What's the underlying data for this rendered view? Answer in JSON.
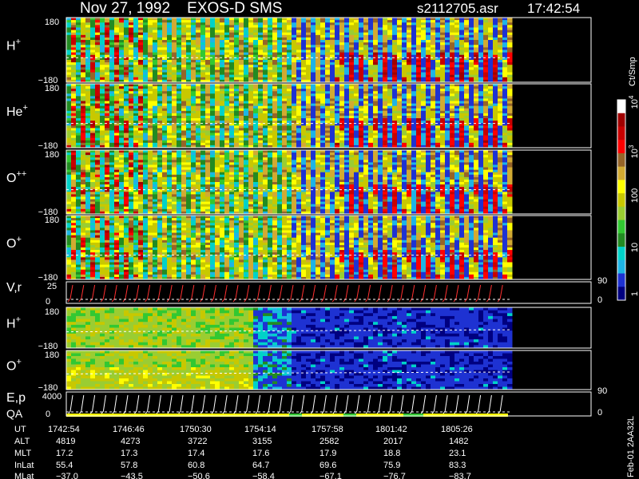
{
  "header": {
    "title": "Nov 27, 1992    EXOS-D SMS",
    "file": "s2112705.asr",
    "time": "17:42:54"
  },
  "chart_data": {
    "type": "heatmap",
    "panels": [
      {
        "label": "H",
        "sup": "+",
        "ytop": "180",
        "ybot": "−180",
        "kind": "spin",
        "intensity": 1.0
      },
      {
        "label": "He",
        "sup": "+",
        "ytop": "180",
        "ybot": "−180",
        "kind": "spin",
        "intensity": 0.85
      },
      {
        "label": "O",
        "sup": "++",
        "ytop": "180",
        "ybot": "−180",
        "kind": "spin",
        "intensity": 0.8
      },
      {
        "label": "O",
        "sup": "+",
        "ytop": "180",
        "ybot": "−180",
        "kind": "spin",
        "intensity": 0.75
      },
      {
        "label": "V,r",
        "sup": "",
        "ytop": "25",
        "ybot": "0",
        "kind": "line",
        "right_top": "90",
        "right_bot": "0"
      },
      {
        "label": "H",
        "sup": "+",
        "ytop": "180",
        "ybot": "−180",
        "kind": "smooth"
      },
      {
        "label": "O",
        "sup": "+",
        "ytop": "180",
        "ybot": "−180",
        "kind": "smooth"
      },
      {
        "label": "E,p",
        "label2": "QA",
        "sup": "",
        "ytop": "4000",
        "ybot": "0",
        "kind": "line",
        "right_top": "90",
        "right_bot": "0"
      }
    ],
    "colorbar": {
      "unit": "Ct/Smp",
      "ticks": [
        {
          "base": "10",
          "exp": "4"
        },
        {
          "base": "10",
          "exp": "3"
        },
        {
          "base": "100",
          "exp": ""
        },
        {
          "base": "10",
          "exp": ""
        },
        {
          "base": "1",
          "exp": ""
        }
      ],
      "colors": [
        "#000080",
        "#1e32d2",
        "#1eb4e6",
        "#00d2c8",
        "#228b22",
        "#32c832",
        "#9acd32",
        "#c8c800",
        "#ffff00",
        "#d2aa32",
        "#966428",
        "#ff0000",
        "#c80000",
        "#a00000",
        "#ffffff"
      ]
    },
    "side_label": "Feb-01 2AA32L",
    "ephemeris": {
      "labels": [
        "UT",
        "ALT",
        "MLT",
        "InLat",
        "MLat"
      ],
      "columns": [
        {
          "UT": "1742:54",
          "ALT": "4819",
          "MLT": "17.2",
          "InLat": "55.4",
          "MLat": "−37.0"
        },
        {
          "UT": "1746:46",
          "ALT": "4273",
          "MLT": "17.3",
          "InLat": "57.8",
          "MLat": "−43.5"
        },
        {
          "UT": "1750:30",
          "ALT": "3722",
          "MLT": "17.4",
          "InLat": "60.8",
          "MLat": "−50.6"
        },
        {
          "UT": "1754:14",
          "ALT": "3155",
          "MLT": "17.6",
          "InLat": "64.7",
          "MLat": "−58.4"
        },
        {
          "UT": "1757:58",
          "ALT": "2582",
          "MLT": "17.9",
          "InLat": "69.6",
          "MLat": "−67.1"
        },
        {
          "UT": "1801:42",
          "ALT": "2017",
          "MLT": "18.8",
          "InLat": "75.9",
          "MLat": "−76.7"
        },
        {
          "UT": "1805:26",
          "ALT": "1482",
          "MLT": "23.1",
          "InLat": "83.3",
          "MLat": "−83.7"
        }
      ]
    }
  }
}
